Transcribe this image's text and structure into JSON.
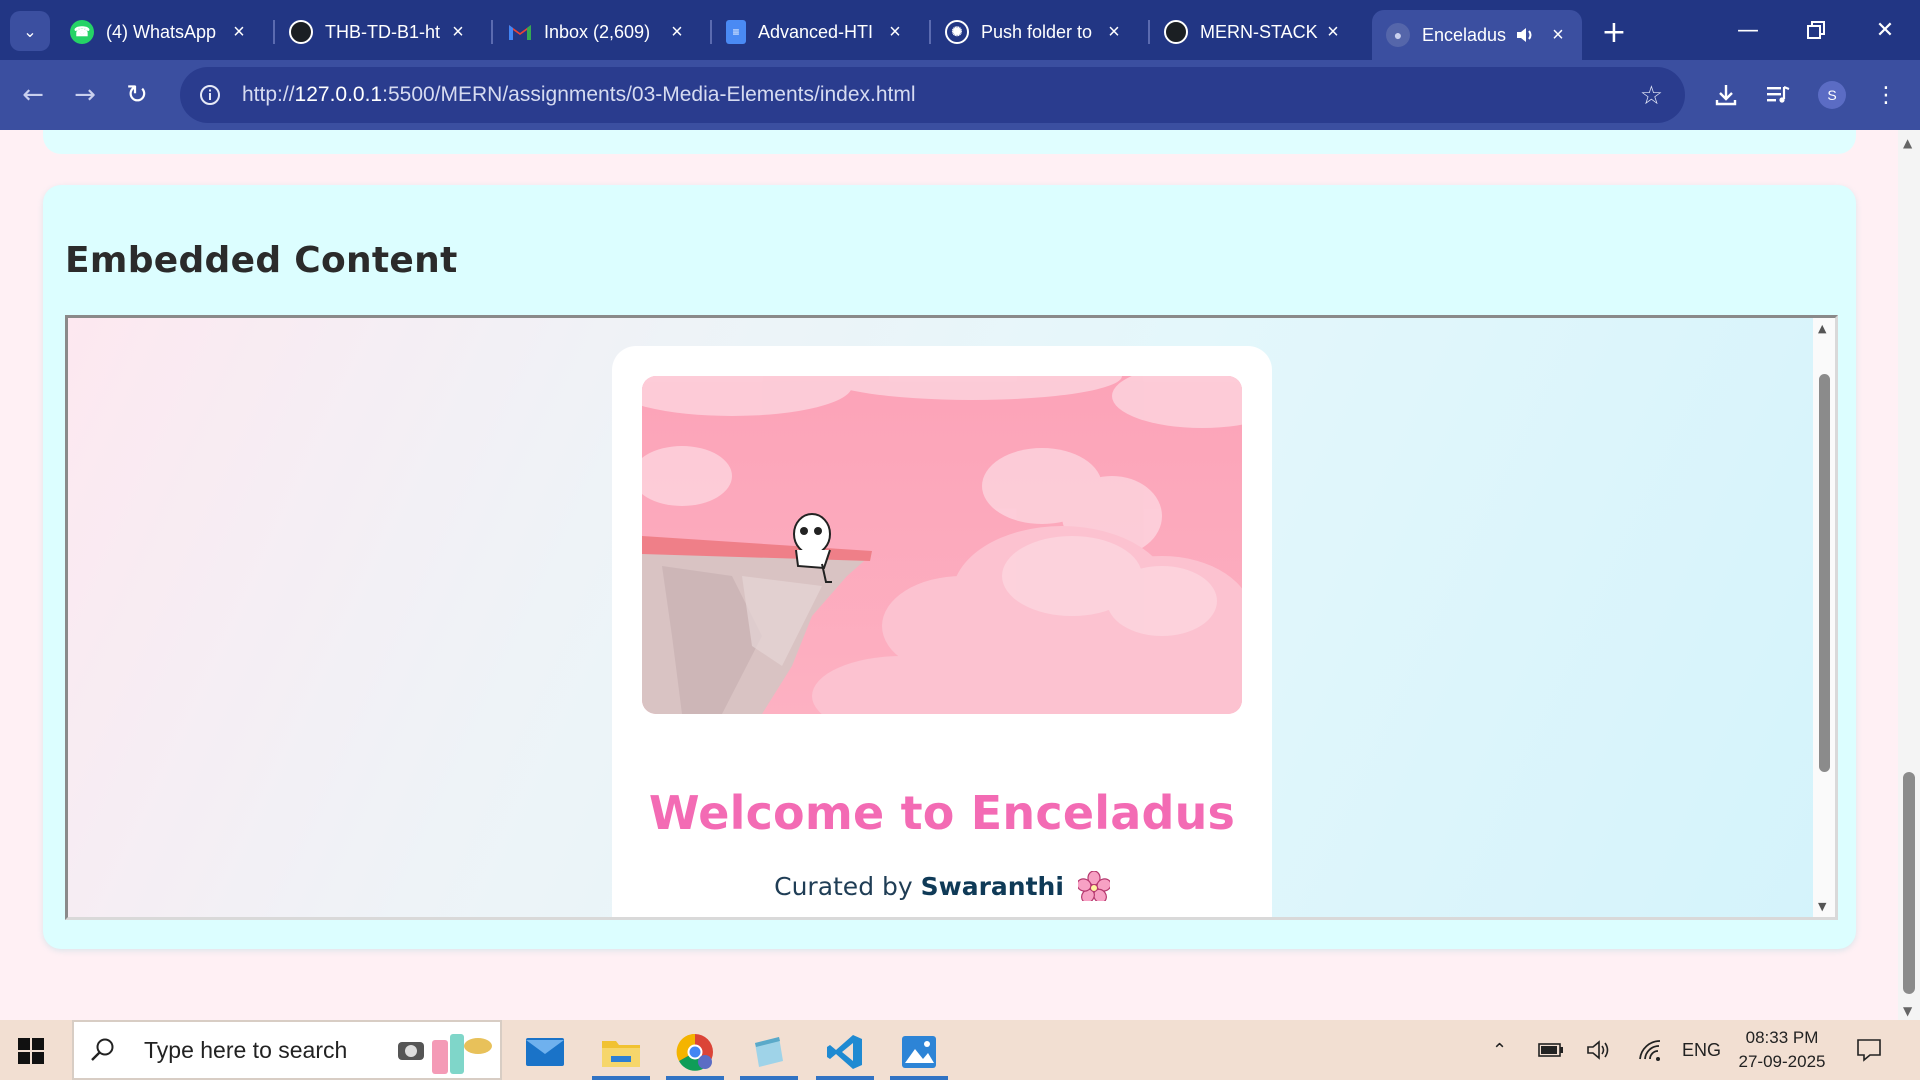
{
  "tabs": [
    {
      "title": "(4) WhatsApp",
      "icon": "whatsapp-icon"
    },
    {
      "title": "THB-TD-B1-ht",
      "icon": "github-icon"
    },
    {
      "title": "Inbox (2,609)",
      "icon": "gmail-icon"
    },
    {
      "title": "Advanced-HTI",
      "icon": "docs-icon"
    },
    {
      "title": "Push folder to",
      "icon": "chatgpt-icon"
    },
    {
      "title": "MERN-STACK",
      "icon": "github-icon"
    },
    {
      "title": "Enceladus",
      "icon": "globe-icon",
      "active": true
    }
  ],
  "address_bar": {
    "url_host": "127.0.0.1",
    "url_prefix": "http://",
    "url_rest": ":5500/MERN/assignments/03-Media-Elements/index.html"
  },
  "profile_initial": "S",
  "page": {
    "section_title": "Embedded Content",
    "embedded": {
      "welcome_title": "Welcome to Enceladus",
      "curated_prefix": "Curated by",
      "curator": "Swaranthi"
    }
  },
  "taskbar": {
    "search_placeholder": "Type here to search",
    "language": "ENG",
    "time": "08:33 PM",
    "date": "27-09-2025"
  },
  "colors": {
    "tabstrip": "#223684",
    "toolbar": "#3b4fa0",
    "card_bg": "#dcfeff",
    "welcome_title": "#f36bb4",
    "page_bg": "#fff0f4"
  }
}
